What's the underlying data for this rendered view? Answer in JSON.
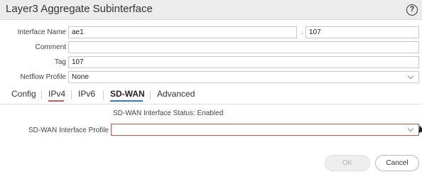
{
  "dialog": {
    "title": "Layer3 Aggregate Subinterface",
    "help_icon": "question-circle-icon"
  },
  "form": {
    "interface_name": {
      "label": "Interface Name",
      "value": "ae1",
      "separator": ".",
      "suffix": "107"
    },
    "comment": {
      "label": "Comment",
      "value": ""
    },
    "tag": {
      "label": "Tag",
      "value": "107"
    },
    "netflow_profile": {
      "label": "Netflow Profile",
      "value": "None"
    }
  },
  "tabs": [
    {
      "label": "Config"
    },
    {
      "label": "IPv4"
    },
    {
      "label": "IPv6"
    },
    {
      "label": "SD-WAN",
      "active": true
    },
    {
      "label": "Advanced"
    }
  ],
  "sdwan": {
    "status_text": "SD-WAN Interface Status: Enabled",
    "profile_label": "SD-WAN Interface Profile",
    "profile_value": ""
  },
  "buttons": {
    "ok": "OK",
    "cancel": "Cancel"
  },
  "colors": {
    "accent_underline": "#2d7fc1",
    "error_underline": "#d9534f",
    "error_border": "#d9534f",
    "titlebar_bg": "#ececec"
  }
}
